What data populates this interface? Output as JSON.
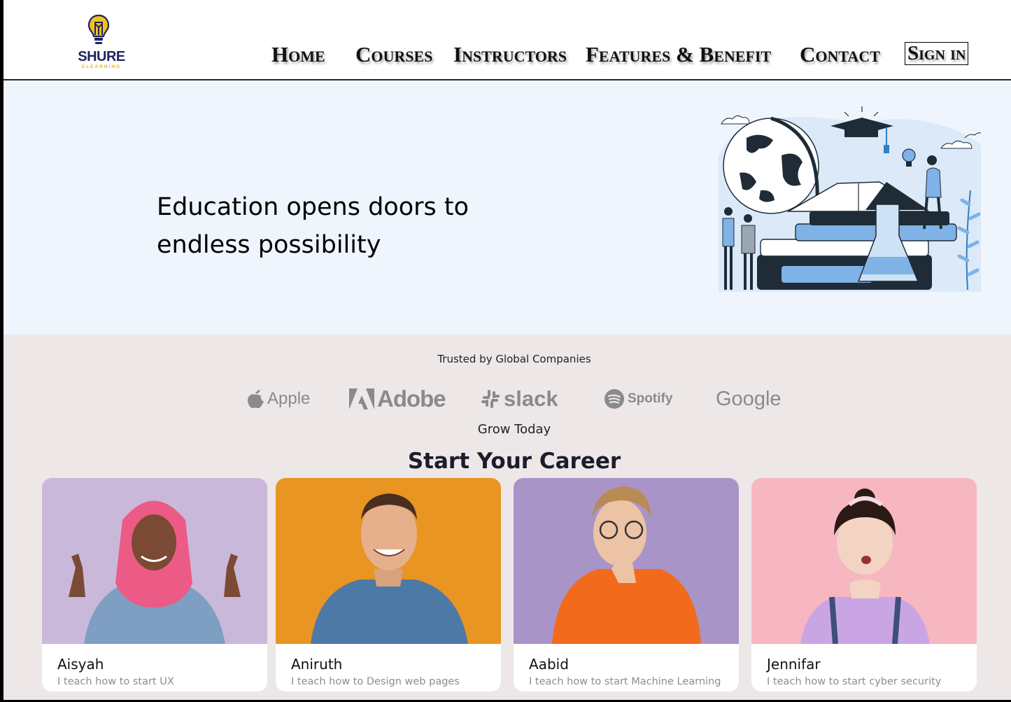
{
  "brand": {
    "name": "SHURE",
    "sub": "ELEARNING",
    "primary": "#1f2363",
    "accent": "#e9b41c"
  },
  "nav": {
    "home": "Home",
    "courses": "Courses",
    "instructors": "Instructors",
    "features": "Features & Benefit",
    "contact": "Contact",
    "signin": "Sign in"
  },
  "hero": {
    "line1": "Education opens doors to",
    "line2": "endless possibility",
    "background": "#eff5fd",
    "illustration": "education-illustration"
  },
  "companies": {
    "heading": "Trusted by Global Companies",
    "items": [
      {
        "name": "Apple",
        "icon": "apple-icon"
      },
      {
        "name": "Adobe",
        "icon": "adobe-icon"
      },
      {
        "name": "slack",
        "icon": "slack-icon"
      },
      {
        "name": "Spotify",
        "icon": "spotify-icon"
      },
      {
        "name": "Google",
        "icon": "google-logo"
      }
    ]
  },
  "career": {
    "eyebrow": "Grow Today",
    "title": "Start Your Career",
    "instructors": [
      {
        "name": "Aisyah",
        "desc": "I teach how to start UX",
        "bg": "#c9b8da"
      },
      {
        "name": "Aniruth",
        "desc": "I teach how to Design web pages",
        "bg": "#e99523"
      },
      {
        "name": "Aabid",
        "desc": "I teach how to start Machine Learning",
        "bg": "#a994c8"
      },
      {
        "name": "Jennifar",
        "desc": "I teach how to start cyber security",
        "bg": "#f6b7c0"
      }
    ]
  }
}
